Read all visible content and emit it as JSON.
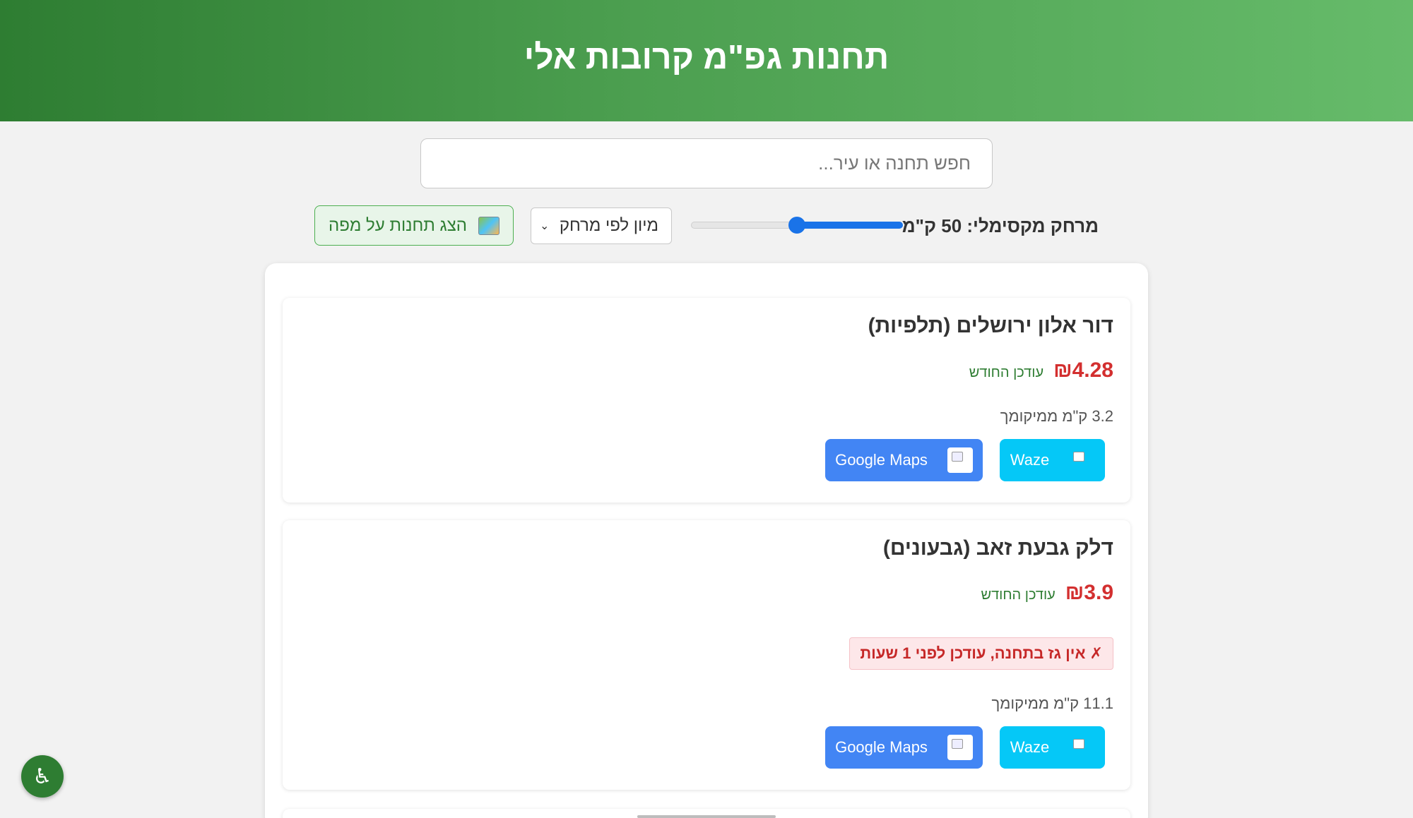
{
  "header": {
    "title": "תחנות גפ\"מ קרובות אלי"
  },
  "search": {
    "placeholder": "חפש תחנה או עיר..."
  },
  "controls": {
    "distance_label": "מרחק מקסימלי: 50 ק\"מ",
    "max_distance_value": 0.5,
    "sort_label": "מיון לפי מרחק",
    "map_button_label": "הצג תחנות על מפה"
  },
  "stations": [
    {
      "name": "דור אלון ירושלים (תלפיות)",
      "price": "₪4.28",
      "updated": "עודכן החודש",
      "distance": "3.2 ק\"מ ממיקומך",
      "waze_label": "Waze",
      "gmaps_label": "Google Maps"
    },
    {
      "name": "דלק גבעת זאב (גבעונים)",
      "price": "₪3.9",
      "updated": "עודכן החודש",
      "alert": "✗ אין גז בתחנה, עודכן לפני 1 שעות",
      "distance": "11.1 ק\"מ ממיקומך",
      "waze_label": "Waze",
      "gmaps_label": "Google Maps"
    }
  ],
  "accessibility": {
    "icon": "♿"
  },
  "colors": {
    "accent": "#2e7d32",
    "price": "#d32f2f",
    "waze": "#05c8f7",
    "gmaps": "#4285f4"
  }
}
